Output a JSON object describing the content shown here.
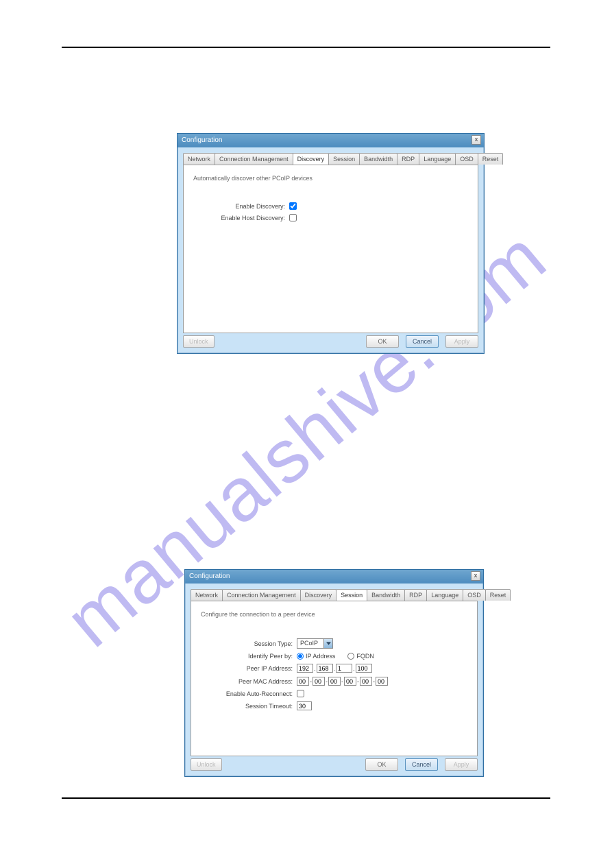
{
  "watermark": "manualshive.com",
  "common": {
    "dialog_title": "Configuration",
    "close_x": "x",
    "tabs": {
      "network": "Network",
      "connection_management": "Connection Management",
      "discovery": "Discovery",
      "session": "Session",
      "bandwidth": "Bandwidth",
      "rdp": "RDP",
      "language": "Language",
      "osd": "OSD",
      "reset": "Reset"
    },
    "buttons": {
      "unlock": "Unlock",
      "ok": "OK",
      "cancel": "Cancel",
      "apply": "Apply"
    }
  },
  "dialog1": {
    "description": "Automatically discover other PCoIP devices",
    "fields": {
      "enable_discovery_label": "Enable Discovery:",
      "enable_host_discovery_label": "Enable Host Discovery:"
    },
    "values": {
      "enable_discovery": true,
      "enable_host_discovery": false
    }
  },
  "dialog2": {
    "description": "Configure the connection to a peer device",
    "fields": {
      "session_type_label": "Session Type:",
      "identify_peer_by_label": "Identify Peer by:",
      "ip_address_option": "IP Address",
      "fqdn_option": "FQDN",
      "peer_ip_label": "Peer IP Address:",
      "peer_mac_label": "Peer MAC Address:",
      "enable_auto_reconnect_label": "Enable Auto-Reconnect:",
      "session_timeout_label": "Session Timeout:"
    },
    "values": {
      "session_type": "PCoIP",
      "identify_peer_by": "ip",
      "peer_ip": [
        "192",
        "168",
        "1",
        "100"
      ],
      "peer_mac": [
        "00",
        "00",
        "00",
        "00",
        "00",
        "00"
      ],
      "enable_auto_reconnect": false,
      "session_timeout": "30"
    }
  }
}
